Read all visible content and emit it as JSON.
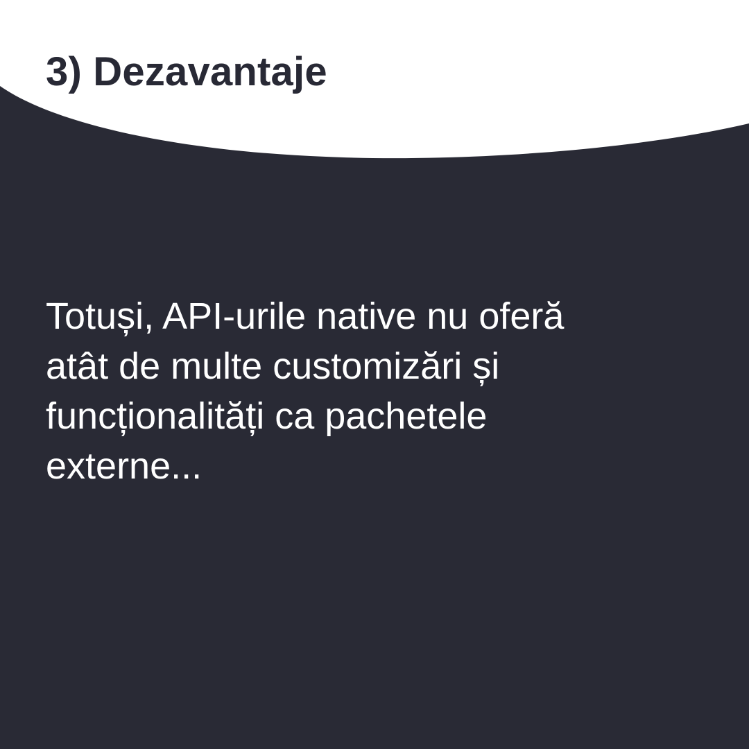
{
  "slide": {
    "title": "3) Dezavantaje",
    "body_lines": [
      "Totuși, API-urile native nu oferă",
      "atât de multe customizări și",
      "funcționalități ca pachetele",
      "externe..."
    ]
  },
  "colors": {
    "background": "#292a35",
    "header_band": "#ffffff",
    "title": "#282935",
    "body_text": "#ffffff"
  }
}
